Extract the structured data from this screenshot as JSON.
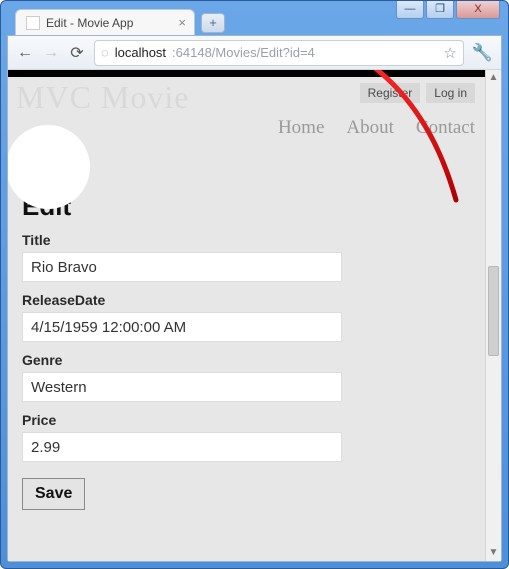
{
  "window": {
    "min": "—",
    "max": "❐",
    "close": "X"
  },
  "tab": {
    "title": "Edit - Movie App",
    "close": "×",
    "newtab": "+"
  },
  "toolbar": {
    "back": "←",
    "forward": "→",
    "reload": "⟳",
    "globe": "◌",
    "url_host": "localhost",
    "url_rest": ":64148/Movies/Edit?id=4",
    "star": "☆",
    "wrench": "🔧"
  },
  "header": {
    "brand": "MVC Movie",
    "register": "Register",
    "login": "Log in",
    "nav": {
      "home": "Home",
      "about": "About",
      "contact": "Contact"
    }
  },
  "form": {
    "heading": "Edit",
    "title_label": "Title",
    "title_value": "Rio Bravo",
    "releasedate_label": "ReleaseDate",
    "releasedate_value": "4/15/1959 12:00:00 AM",
    "genre_label": "Genre",
    "genre_value": "Western",
    "price_label": "Price",
    "price_value": "2.99",
    "save": "Save"
  },
  "scrollbar": {
    "up": "▲",
    "down": "▼"
  }
}
